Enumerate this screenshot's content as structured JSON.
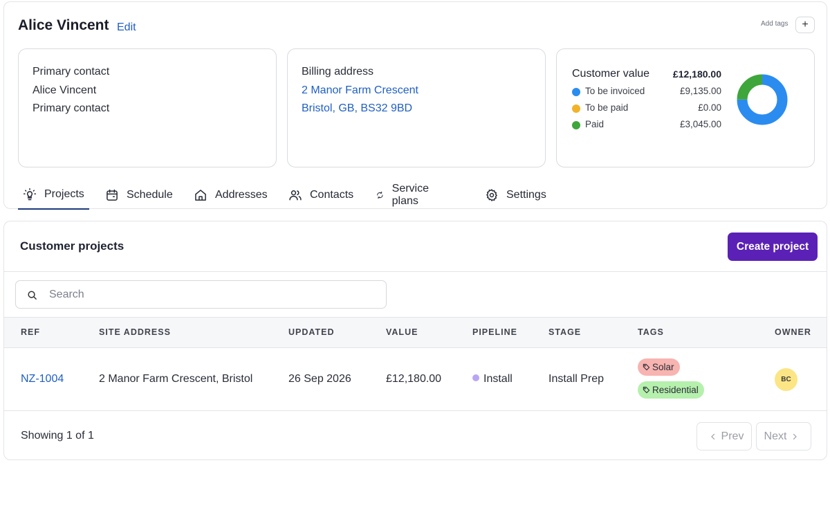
{
  "customer": {
    "name": "Alice Vincent",
    "edit_label": "Edit",
    "add_tags_label": "Add tags",
    "add_tags_icon": "+"
  },
  "contact": {
    "title": "Primary contact",
    "name": "Alice Vincent",
    "role": "Primary contact"
  },
  "billing": {
    "title": "Billing address",
    "line1": "2 Manor Farm Crescent",
    "line2": "Bristol, GB, BS32 9BD"
  },
  "customer_value": {
    "title": "Customer value",
    "total": "£12,180.00",
    "items": [
      {
        "label": "To be invoiced",
        "value": "£9,135.00",
        "amount": 9135,
        "color": "#2b8cf0"
      },
      {
        "label": "To be paid",
        "value": "£0.00",
        "amount": 0,
        "color": "#f2b329"
      },
      {
        "label": "Paid",
        "value": "£3,045.00",
        "amount": 3045,
        "color": "#3ea63a"
      }
    ]
  },
  "tabs": [
    {
      "label": "Projects",
      "icon": "lightbulb-icon",
      "active": true
    },
    {
      "label": "Schedule",
      "icon": "calendar-icon",
      "active": false
    },
    {
      "label": "Addresses",
      "icon": "home-icon",
      "active": false
    },
    {
      "label": "Contacts",
      "icon": "users-icon",
      "active": false
    },
    {
      "label": "Service plans",
      "icon": "refresh-icon",
      "active": false
    },
    {
      "label": "Settings",
      "icon": "gear-icon",
      "active": false
    }
  ],
  "projects": {
    "title": "Customer projects",
    "create_label": "Create project",
    "search_placeholder": "Search",
    "columns": [
      "REF",
      "SITE ADDRESS",
      "UPDATED",
      "VALUE",
      "PIPELINE",
      "STAGE",
      "TAGS",
      "OWNER"
    ],
    "rows": [
      {
        "ref": "NZ-1004",
        "site_address": "2 Manor Farm Crescent, Bristol",
        "updated": "26 Sep 2026",
        "value": "£12,180.00",
        "pipeline": "Install",
        "stage": "Install Prep",
        "tags": [
          {
            "label": "Solar",
            "color": "#f7b4b0"
          },
          {
            "label": "Residential",
            "color": "#b5f0ad"
          }
        ],
        "owner_initials": "BC"
      }
    ],
    "showing": "Showing 1 of 1",
    "prev_label": "Prev",
    "next_label": "Next"
  }
}
